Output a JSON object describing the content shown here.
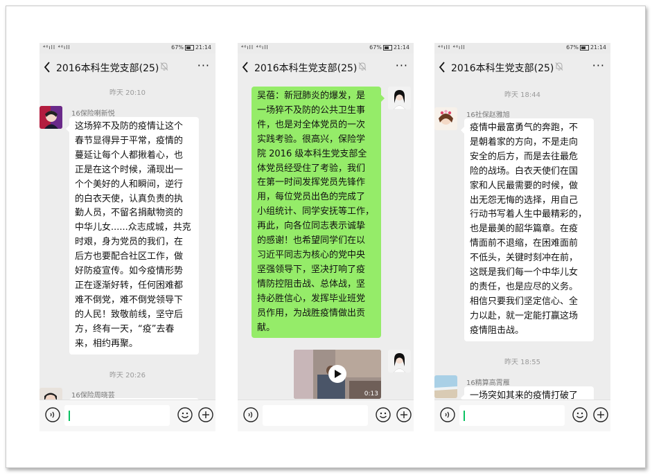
{
  "status_bar": {
    "signal": "⁴⁶ıll ⁴⁶ıll",
    "battery": "67%",
    "time": "21:14"
  },
  "chat": {
    "title": "2016本科生党支部(25)",
    "more": "···"
  },
  "phones": [
    {
      "messages": [
        {
          "type": "timestamp",
          "text": "昨天 20:10"
        },
        {
          "type": "incoming",
          "sender": "16保险喇新悦",
          "text": "这场猝不及防的疫情让这个\n春节显得异于平常，疫情的\n蔓延让每个人都揪着心，也\n正是在这个时候，涌现出一\n个个美好的人和瞬间，逆行\n的白衣天使，认真负责的执\n勤人员，不留名捐献物资的\n中华儿女......众志成城，共克\n时艰，身为党员的我们，在\n后方也要配合社区工作，做\n好防疫宣传。如今疫情形势\n正在逐渐好转，任何困难都\n难不倒党，难不倒党领导下\n的人民！致敬前线，坚守后\n方，终有一天，“疫”去春\n来，相约再聚。"
        },
        {
          "type": "timestamp",
          "text": "昨天 20:26"
        },
        {
          "type": "incoming",
          "sender": "16保险周晓芸",
          "text": ""
        }
      ]
    },
    {
      "messages": [
        {
          "type": "outgoing",
          "text": "吴蓓：新冠肺炎的爆发，是\n一场猝不及防的公共卫生事\n件，也是对全体党员的一次\n实践考验。很高兴，保险学\n院 2016 级本科生党支部全\n体党员经受住了考验，我们\n在第一时间发挥党员先锋作\n用，每位党员出色的完成了\n小组统计、同学安抚等工作，\n再此，向各位同志表示诚挚\n的感谢！也希望同学们在以\n习近平同志为核心的党中央\n坚强领导下，坚决打响了疫\n情防控阻击战、总体战，坚\n持必胜信心，发挥毕业班党\n员作用，为战胜疫情做出贡\n献。"
        },
        {
          "type": "video",
          "duration": "0:13"
        }
      ]
    },
    {
      "messages": [
        {
          "type": "timestamp",
          "text": "昨天 18:44"
        },
        {
          "type": "incoming",
          "sender": "16社保赵雅旭",
          "text": "疫情中最富勇气的奔跑，不\n是朝着家的方向，不是走向\n安全的后方，而是去往最危\n险的战场。白衣天使们在国\n家和人民最需要的时候，做\n出无怨无悔的选择，用自己\n行动书写着人生中最精彩的，\n也是最美的韶华篇章。在疫\n情面前不退缩，在困难面前\n不低头，关键时刻冲在前，\n这既是我们每一个中华儿女\n的责任，也是应尽的义务。\n相信只要我们坚定信心、全\n力以赴，就一定能打赢这场\n疫情阻击战。"
        },
        {
          "type": "timestamp",
          "text": "昨天 18:55"
        },
        {
          "type": "incoming",
          "sender": "16精算高霄雁",
          "text": "一场突如其来的疫情打破了"
        }
      ]
    }
  ]
}
